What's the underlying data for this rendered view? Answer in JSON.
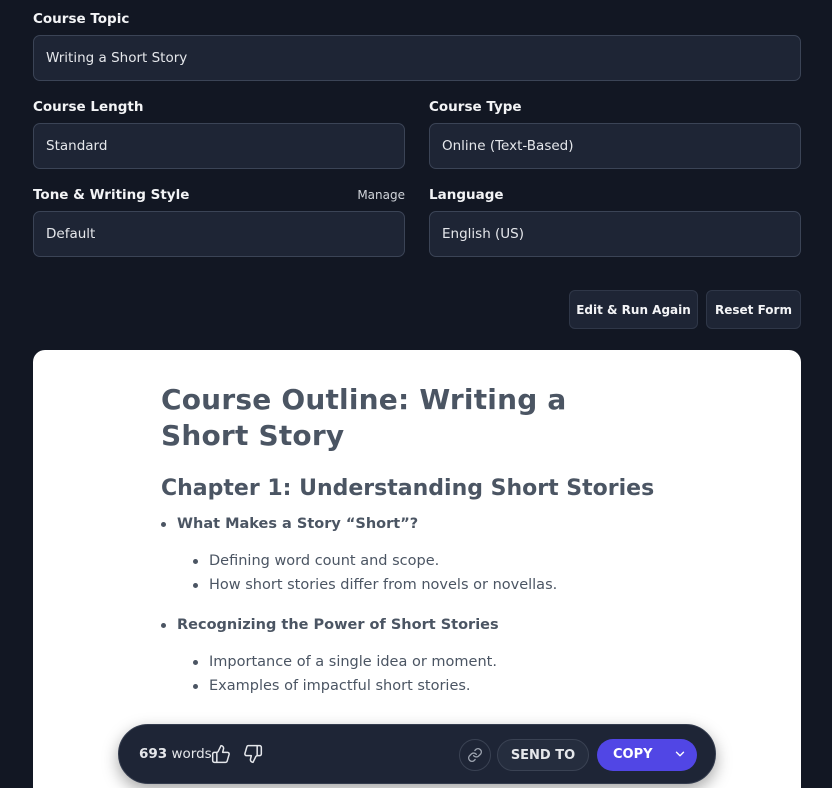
{
  "form": {
    "topic": {
      "label": "Course Topic",
      "value": "Writing a Short Story"
    },
    "length": {
      "label": "Course Length",
      "value": "Standard"
    },
    "type": {
      "label": "Course Type",
      "value": "Online (Text-Based)"
    },
    "tone": {
      "label": "Tone & Writing Style",
      "value": "Default",
      "manage_label": "Manage"
    },
    "language": {
      "label": "Language",
      "value": "English (US)"
    }
  },
  "actions": {
    "edit_run_label": "Edit & Run Again",
    "reset_label": "Reset Form"
  },
  "document": {
    "title": "Course Outline: Writing a Short Story",
    "chapter": "Chapter 1: Understanding Short Stories",
    "sections": [
      {
        "heading": "What Makes a Story “Short”?",
        "bullets": [
          "Defining word count and scope.",
          "How short stories differ from novels or novellas."
        ]
      },
      {
        "heading": "Recognizing the Power of Short Stories",
        "bullets": [
          "Importance of a single idea or moment.",
          "Examples of impactful short stories."
        ]
      }
    ]
  },
  "toolbar": {
    "word_count": "693",
    "words_label": "words",
    "send_label": "SEND TO",
    "copy_label": "COPY"
  },
  "icons": {
    "like": "thumbs-up-icon",
    "dislike": "thumbs-down-icon",
    "link": "link-icon",
    "chevron": "chevron-down-icon"
  },
  "colors": {
    "background": "#121723",
    "field": "#1e2535",
    "accent": "#5146e5",
    "doc_text": "#4b5563"
  }
}
